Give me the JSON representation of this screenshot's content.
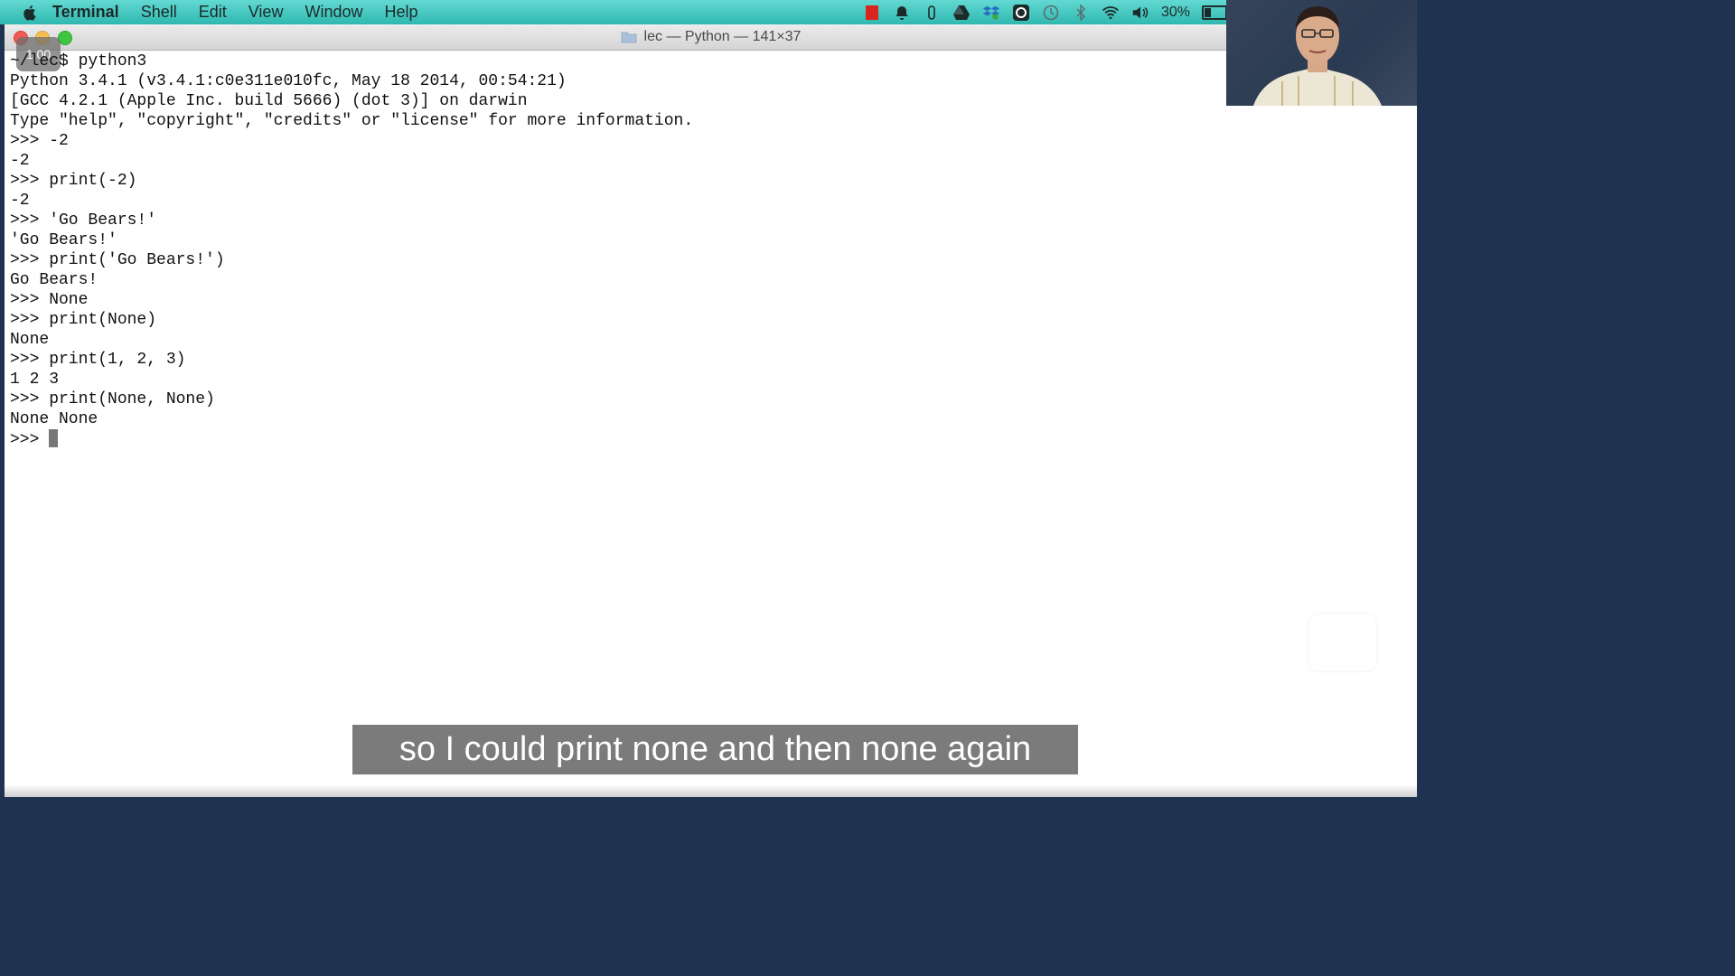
{
  "menubar": {
    "app_name": "Terminal",
    "items": [
      "Shell",
      "Edit",
      "View",
      "Window",
      "Help"
    ],
    "battery_percent": "30%",
    "battery_level": 0.3
  },
  "window": {
    "title": "lec — Python — 141×37",
    "speed_badge": "1.00"
  },
  "terminal": {
    "lines": [
      "~/lec$ python3",
      "Python 3.4.1 (v3.4.1:c0e311e010fc, May 18 2014, 00:54:21)",
      "[GCC 4.2.1 (Apple Inc. build 5666) (dot 3)] on darwin",
      "Type \"help\", \"copyright\", \"credits\" or \"license\" for more information.",
      ">>> -2",
      "-2",
      ">>> print(-2)",
      "-2",
      ">>> 'Go Bears!'",
      "'Go Bears!'",
      ">>> print('Go Bears!')",
      "Go Bears!",
      ">>> None",
      ">>> print(None)",
      "None",
      ">>> print(1, 2, 3)",
      "1 2 3",
      ">>> print(None, None)",
      "None None"
    ],
    "prompt": ">>> "
  },
  "subtitle": "so I could print none and then none again",
  "colors": {
    "menubar": "#2fb8b0",
    "terminal_bg": "#ffffff",
    "subtitle_bg": "#696969"
  }
}
